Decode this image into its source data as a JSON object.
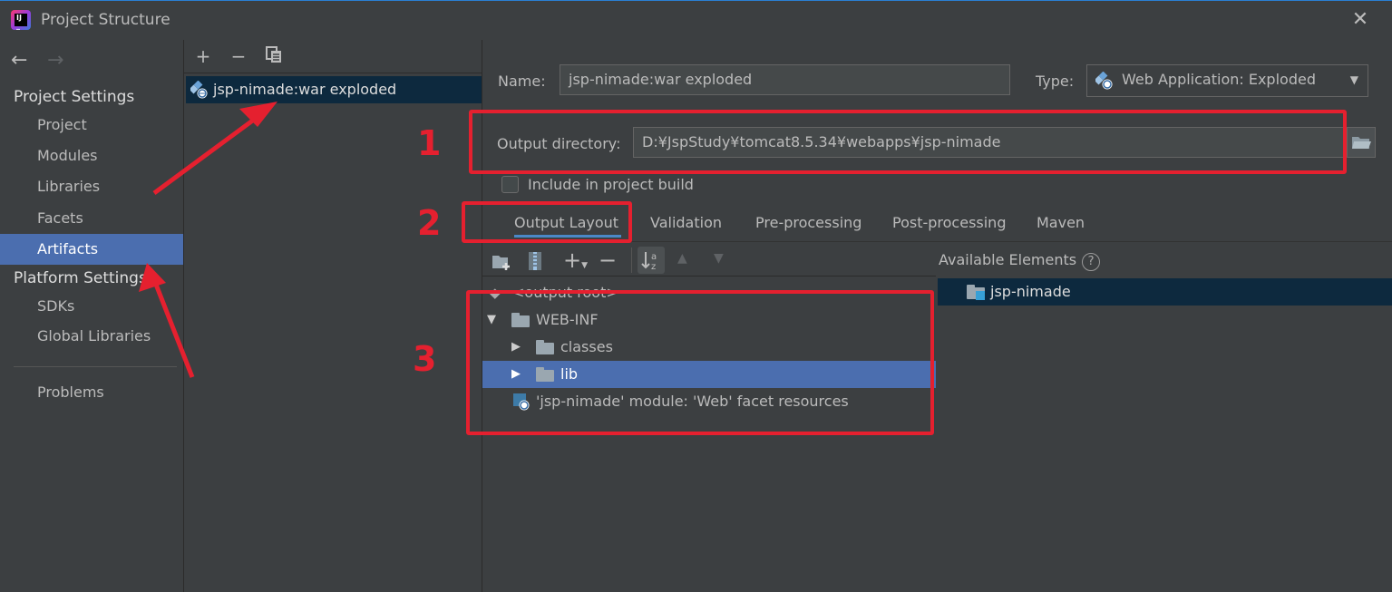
{
  "window": {
    "title": "Project Structure",
    "close": "✕"
  },
  "nav": {
    "back": "←",
    "forward": "→",
    "project_settings_header": "Project Settings",
    "project_settings_items": [
      "Project",
      "Modules",
      "Libraries",
      "Facets",
      "Artifacts"
    ],
    "selected_item": "Artifacts",
    "platform_settings_header": "Platform Settings",
    "platform_settings_items": [
      "SDKs",
      "Global Libraries"
    ],
    "problems": "Problems"
  },
  "artifacts_list": {
    "toolbar": {
      "add": "+",
      "remove": "−",
      "copy": "copy-icon"
    },
    "items": [
      "jsp-nimade:war exploded"
    ]
  },
  "artifact": {
    "name_label": "Name:",
    "name_value": "jsp-nimade:war exploded",
    "type_label": "Type:",
    "type_value": "Web Application: Exploded",
    "output_dir_label": "Output directory:",
    "output_dir_value": "D:¥JspStudy¥tomcat8.5.34¥webapps¥jsp-nimade",
    "include_in_build_label": "Include in project build",
    "include_in_build_checked": false
  },
  "tabs": [
    "Output Layout",
    "Validation",
    "Pre-processing",
    "Post-processing",
    "Maven"
  ],
  "active_tab": "Output Layout",
  "layout_tree": {
    "rows": [
      {
        "label": "<output root>"
      },
      {
        "label": "WEB-INF"
      },
      {
        "label": "classes"
      },
      {
        "label": "lib"
      },
      {
        "label": "'jsp-nimade' module: 'Web' facet resources"
      }
    ],
    "selected": "lib"
  },
  "available_elements": {
    "header": "Available Elements",
    "help": "?",
    "items": [
      "jsp-nimade"
    ]
  },
  "annotations": {
    "labels": [
      "1",
      "2",
      "3"
    ],
    "color": "#e5202f"
  },
  "colors": {
    "background": "#3c3f41",
    "selection": "#4b6eaf",
    "list_selection": "#0d293e"
  }
}
